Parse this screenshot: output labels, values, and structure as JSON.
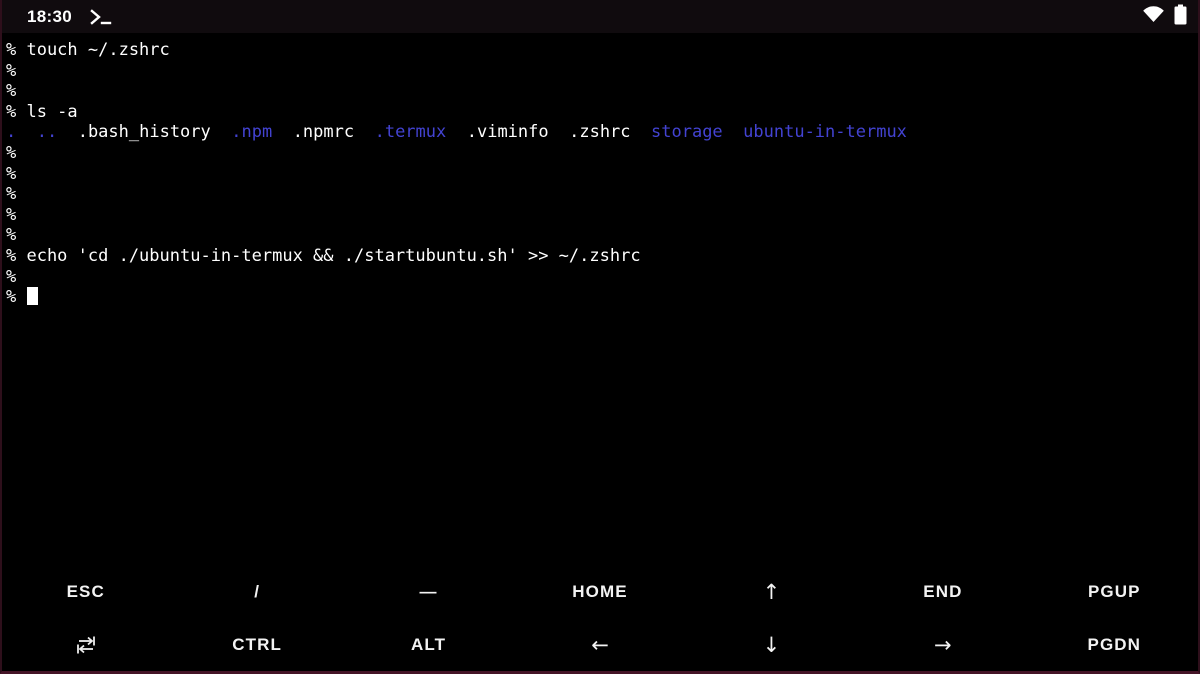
{
  "status_bar": {
    "time": "18:30",
    "icons": [
      "termux-notification-icon",
      "wifi-icon",
      "battery-icon"
    ]
  },
  "terminal": {
    "colors": {
      "foreground": "#ffffff",
      "directory": "#4343d2",
      "background": "#000000"
    },
    "prompt": "%",
    "lines": [
      {
        "segments": [
          {
            "t": "% touch ~/.zshrc"
          }
        ]
      },
      {
        "segments": [
          {
            "t": "%"
          }
        ]
      },
      {
        "segments": [
          {
            "t": "%"
          }
        ]
      },
      {
        "segments": [
          {
            "t": "% ls -a"
          }
        ]
      },
      {
        "segments": [
          {
            "t": ".",
            "c": "directory"
          },
          {
            "t": "  "
          },
          {
            "t": "..",
            "c": "directory"
          },
          {
            "t": "  "
          },
          {
            "t": ".bash_history"
          },
          {
            "t": "  "
          },
          {
            "t": ".npm",
            "c": "directory"
          },
          {
            "t": "  "
          },
          {
            "t": ".npmrc"
          },
          {
            "t": "  "
          },
          {
            "t": ".termux",
            "c": "directory"
          },
          {
            "t": "  "
          },
          {
            "t": ".viminfo"
          },
          {
            "t": "  "
          },
          {
            "t": ".zshrc"
          },
          {
            "t": "  "
          },
          {
            "t": "storage",
            "c": "directory"
          },
          {
            "t": "  "
          },
          {
            "t": "ubuntu-in-termux",
            "c": "directory"
          }
        ]
      },
      {
        "segments": [
          {
            "t": "%"
          }
        ]
      },
      {
        "segments": [
          {
            "t": "%"
          }
        ]
      },
      {
        "segments": [
          {
            "t": "%"
          }
        ]
      },
      {
        "segments": [
          {
            "t": "%"
          }
        ]
      },
      {
        "segments": [
          {
            "t": "%"
          }
        ]
      },
      {
        "segments": [
          {
            "t": "% echo 'cd ./ubuntu-in-termux && ./startubuntu.sh' >> ~/.zshrc"
          }
        ]
      },
      {
        "segments": [
          {
            "t": "%"
          }
        ]
      },
      {
        "segments": [
          {
            "t": "% "
          }
        ],
        "cursor": true
      }
    ]
  },
  "keyboard": {
    "rows": [
      [
        {
          "name": "key-esc",
          "label": "ESC"
        },
        {
          "name": "key-slash",
          "label": "/"
        },
        {
          "name": "key-minus",
          "label": "―"
        },
        {
          "name": "key-home",
          "label": "HOME"
        },
        {
          "name": "key-arrow-up",
          "label": "↑",
          "style": "arrow"
        },
        {
          "name": "key-end",
          "label": "END"
        },
        {
          "name": "key-pgup",
          "label": "PGUP"
        }
      ],
      [
        {
          "name": "key-tab",
          "icon": "tab-icon"
        },
        {
          "name": "key-ctrl",
          "label": "CTRL"
        },
        {
          "name": "key-alt",
          "label": "ALT"
        },
        {
          "name": "key-arrow-left",
          "label": "←",
          "style": "arrow"
        },
        {
          "name": "key-arrow-down",
          "label": "↓",
          "style": "arrow"
        },
        {
          "name": "key-arrow-right",
          "label": "→",
          "style": "arrow"
        },
        {
          "name": "key-pgdn",
          "label": "PGDN"
        }
      ]
    ]
  }
}
